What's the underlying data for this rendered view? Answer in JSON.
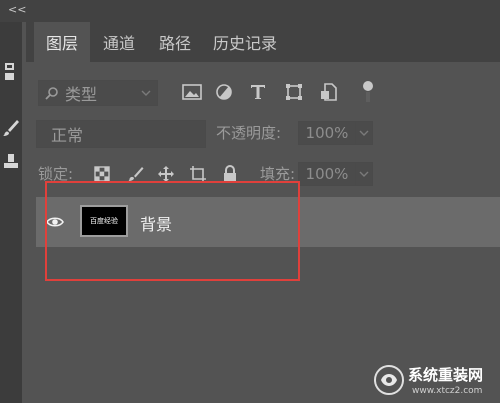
{
  "topbar": {
    "collapse_icon": "double-chevron-left-icon",
    "collapse_text": "<<"
  },
  "toolstrip": {
    "items": [
      {
        "name": "layer-panel-icon"
      },
      {
        "name": "brush-icon"
      },
      {
        "name": "stamp-icon"
      }
    ]
  },
  "tabs": [
    {
      "label": "图层",
      "active": true
    },
    {
      "label": "通道",
      "active": false
    },
    {
      "label": "路径",
      "active": false
    },
    {
      "label": "历史记录",
      "active": false
    }
  ],
  "filter": {
    "kind_label": "类型",
    "icons": [
      "image-filter-icon",
      "adjustment-filter-icon",
      "type-filter-icon",
      "shape-filter-icon",
      "smart-object-filter-icon",
      "filter-toggle-icon"
    ]
  },
  "blend": {
    "mode": "正常",
    "opacity_label": "不透明度:",
    "opacity_value": "100%"
  },
  "lock": {
    "label": "锁定:",
    "icons": [
      "lock-transparent-icon",
      "lock-image-icon",
      "lock-position-icon",
      "lock-artboard-icon",
      "lock-all-icon"
    ],
    "fill_label": "填充:",
    "fill_value": "100%"
  },
  "layer": {
    "name": "背景",
    "thumb_text": "百度经验",
    "visible_icon": "eye-icon"
  },
  "colors": {
    "highlight": "#e0403b",
    "panel": "#535353",
    "tabbar": "#424242"
  },
  "watermark": {
    "line1": "系统重装网",
    "line2": "www.xtcz2.com"
  }
}
